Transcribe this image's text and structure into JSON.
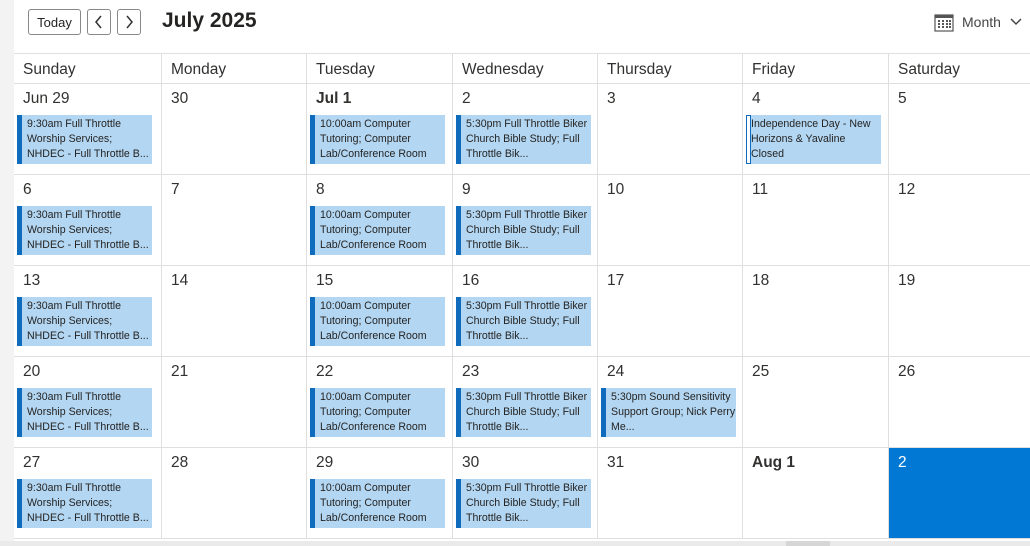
{
  "toolbar": {
    "today_label": "Today",
    "month_title": "July 2025",
    "view_label": "Month"
  },
  "weekdays": [
    "Sunday",
    "Monday",
    "Tuesday",
    "Wednesday",
    "Thursday",
    "Friday",
    "Saturday"
  ],
  "weeks": [
    {
      "days": [
        {
          "label": "Jun 29",
          "bold": false,
          "today": false,
          "event": "9:30am Full Throttle Worship Services; NHDEC - Full Throttle B...",
          "holiday": false
        },
        {
          "label": "30",
          "bold": false,
          "today": false,
          "event": null,
          "holiday": false
        },
        {
          "label": "Jul 1",
          "bold": true,
          "today": false,
          "event": "10:00am Computer Tutoring; Computer Lab/Conference Room",
          "holiday": false
        },
        {
          "label": "2",
          "bold": false,
          "today": false,
          "event": "5:30pm Full Throttle Biker Church Bible Study; Full Throttle Bik...",
          "holiday": false
        },
        {
          "label": "3",
          "bold": false,
          "today": false,
          "event": null,
          "holiday": false
        },
        {
          "label": "4",
          "bold": false,
          "today": false,
          "event": "Independence Day - New Horizons & Yavaline Closed",
          "holiday": true
        },
        {
          "label": "5",
          "bold": false,
          "today": false,
          "event": null,
          "holiday": false
        }
      ]
    },
    {
      "days": [
        {
          "label": "6",
          "bold": false,
          "today": false,
          "event": "9:30am Full Throttle Worship Services; NHDEC - Full Throttle B...",
          "holiday": false
        },
        {
          "label": "7",
          "bold": false,
          "today": false,
          "event": null,
          "holiday": false
        },
        {
          "label": "8",
          "bold": false,
          "today": false,
          "event": "10:00am Computer Tutoring; Computer Lab/Conference Room",
          "holiday": false
        },
        {
          "label": "9",
          "bold": false,
          "today": false,
          "event": "5:30pm Full Throttle Biker Church Bible Study; Full Throttle Bik...",
          "holiday": false
        },
        {
          "label": "10",
          "bold": false,
          "today": false,
          "event": null,
          "holiday": false
        },
        {
          "label": "11",
          "bold": false,
          "today": false,
          "event": null,
          "holiday": false
        },
        {
          "label": "12",
          "bold": false,
          "today": false,
          "event": null,
          "holiday": false
        }
      ]
    },
    {
      "days": [
        {
          "label": "13",
          "bold": false,
          "today": false,
          "event": "9:30am Full Throttle Worship Services; NHDEC - Full Throttle B...",
          "holiday": false
        },
        {
          "label": "14",
          "bold": false,
          "today": false,
          "event": null,
          "holiday": false
        },
        {
          "label": "15",
          "bold": false,
          "today": false,
          "event": "10:00am Computer Tutoring; Computer Lab/Conference Room",
          "holiday": false
        },
        {
          "label": "16",
          "bold": false,
          "today": false,
          "event": "5:30pm Full Throttle Biker Church Bible Study; Full Throttle Bik...",
          "holiday": false
        },
        {
          "label": "17",
          "bold": false,
          "today": false,
          "event": null,
          "holiday": false
        },
        {
          "label": "18",
          "bold": false,
          "today": false,
          "event": null,
          "holiday": false
        },
        {
          "label": "19",
          "bold": false,
          "today": false,
          "event": null,
          "holiday": false
        }
      ]
    },
    {
      "days": [
        {
          "label": "20",
          "bold": false,
          "today": false,
          "event": "9:30am Full Throttle Worship Services; NHDEC - Full Throttle B...",
          "holiday": false
        },
        {
          "label": "21",
          "bold": false,
          "today": false,
          "event": null,
          "holiday": false
        },
        {
          "label": "22",
          "bold": false,
          "today": false,
          "event": "10:00am Computer Tutoring; Computer Lab/Conference Room",
          "holiday": false
        },
        {
          "label": "23",
          "bold": false,
          "today": false,
          "event": "5:30pm Full Throttle Biker Church Bible Study; Full Throttle Bik...",
          "holiday": false
        },
        {
          "label": "24",
          "bold": false,
          "today": false,
          "event": "5:30pm Sound Sensitivity Support Group; Nick Perry Me...",
          "holiday": false
        },
        {
          "label": "25",
          "bold": false,
          "today": false,
          "event": null,
          "holiday": false
        },
        {
          "label": "26",
          "bold": false,
          "today": false,
          "event": null,
          "holiday": false
        }
      ]
    },
    {
      "days": [
        {
          "label": "27",
          "bold": false,
          "today": false,
          "event": "9:30am Full Throttle Worship Services; NHDEC - Full Throttle B...",
          "holiday": false
        },
        {
          "label": "28",
          "bold": false,
          "today": false,
          "event": null,
          "holiday": false
        },
        {
          "label": "29",
          "bold": false,
          "today": false,
          "event": "10:00am Computer Tutoring; Computer Lab/Conference Room",
          "holiday": false
        },
        {
          "label": "30",
          "bold": false,
          "today": false,
          "event": "5:30pm Full Throttle Biker Church Bible Study; Full Throttle Bik...",
          "holiday": false
        },
        {
          "label": "31",
          "bold": false,
          "today": false,
          "event": null,
          "holiday": false
        },
        {
          "label": "Aug 1",
          "bold": true,
          "today": false,
          "event": null,
          "holiday": false
        },
        {
          "label": "2",
          "bold": false,
          "today": true,
          "event": null,
          "holiday": false
        }
      ]
    }
  ],
  "colors": {
    "accent": "#0078d4",
    "event_fill": "#b3d6f2",
    "event_bar": "#0f6cbd"
  },
  "icons": {
    "prev": "chevron-left-icon",
    "next": "chevron-right-icon",
    "view": "calendar-grid-icon",
    "dropdown": "chevron-down-icon"
  }
}
